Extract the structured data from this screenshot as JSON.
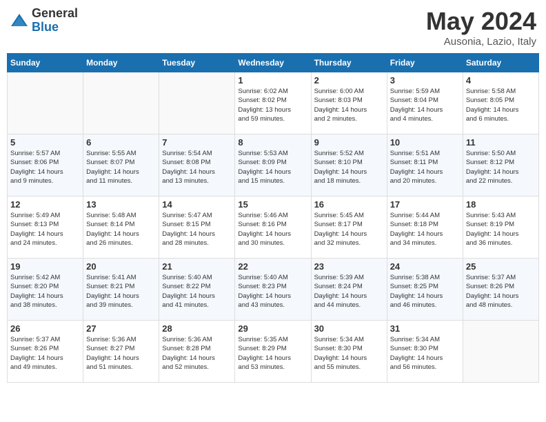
{
  "header": {
    "logo_general": "General",
    "logo_blue": "Blue",
    "month_title": "May 2024",
    "location": "Ausonia, Lazio, Italy"
  },
  "days_of_week": [
    "Sunday",
    "Monday",
    "Tuesday",
    "Wednesday",
    "Thursday",
    "Friday",
    "Saturday"
  ],
  "weeks": [
    [
      {
        "day": "",
        "info": ""
      },
      {
        "day": "",
        "info": ""
      },
      {
        "day": "",
        "info": ""
      },
      {
        "day": "1",
        "info": "Sunrise: 6:02 AM\nSunset: 8:02 PM\nDaylight: 13 hours\nand 59 minutes."
      },
      {
        "day": "2",
        "info": "Sunrise: 6:00 AM\nSunset: 8:03 PM\nDaylight: 14 hours\nand 2 minutes."
      },
      {
        "day": "3",
        "info": "Sunrise: 5:59 AM\nSunset: 8:04 PM\nDaylight: 14 hours\nand 4 minutes."
      },
      {
        "day": "4",
        "info": "Sunrise: 5:58 AM\nSunset: 8:05 PM\nDaylight: 14 hours\nand 6 minutes."
      }
    ],
    [
      {
        "day": "5",
        "info": "Sunrise: 5:57 AM\nSunset: 8:06 PM\nDaylight: 14 hours\nand 9 minutes."
      },
      {
        "day": "6",
        "info": "Sunrise: 5:55 AM\nSunset: 8:07 PM\nDaylight: 14 hours\nand 11 minutes."
      },
      {
        "day": "7",
        "info": "Sunrise: 5:54 AM\nSunset: 8:08 PM\nDaylight: 14 hours\nand 13 minutes."
      },
      {
        "day": "8",
        "info": "Sunrise: 5:53 AM\nSunset: 8:09 PM\nDaylight: 14 hours\nand 15 minutes."
      },
      {
        "day": "9",
        "info": "Sunrise: 5:52 AM\nSunset: 8:10 PM\nDaylight: 14 hours\nand 18 minutes."
      },
      {
        "day": "10",
        "info": "Sunrise: 5:51 AM\nSunset: 8:11 PM\nDaylight: 14 hours\nand 20 minutes."
      },
      {
        "day": "11",
        "info": "Sunrise: 5:50 AM\nSunset: 8:12 PM\nDaylight: 14 hours\nand 22 minutes."
      }
    ],
    [
      {
        "day": "12",
        "info": "Sunrise: 5:49 AM\nSunset: 8:13 PM\nDaylight: 14 hours\nand 24 minutes."
      },
      {
        "day": "13",
        "info": "Sunrise: 5:48 AM\nSunset: 8:14 PM\nDaylight: 14 hours\nand 26 minutes."
      },
      {
        "day": "14",
        "info": "Sunrise: 5:47 AM\nSunset: 8:15 PM\nDaylight: 14 hours\nand 28 minutes."
      },
      {
        "day": "15",
        "info": "Sunrise: 5:46 AM\nSunset: 8:16 PM\nDaylight: 14 hours\nand 30 minutes."
      },
      {
        "day": "16",
        "info": "Sunrise: 5:45 AM\nSunset: 8:17 PM\nDaylight: 14 hours\nand 32 minutes."
      },
      {
        "day": "17",
        "info": "Sunrise: 5:44 AM\nSunset: 8:18 PM\nDaylight: 14 hours\nand 34 minutes."
      },
      {
        "day": "18",
        "info": "Sunrise: 5:43 AM\nSunset: 8:19 PM\nDaylight: 14 hours\nand 36 minutes."
      }
    ],
    [
      {
        "day": "19",
        "info": "Sunrise: 5:42 AM\nSunset: 8:20 PM\nDaylight: 14 hours\nand 38 minutes."
      },
      {
        "day": "20",
        "info": "Sunrise: 5:41 AM\nSunset: 8:21 PM\nDaylight: 14 hours\nand 39 minutes."
      },
      {
        "day": "21",
        "info": "Sunrise: 5:40 AM\nSunset: 8:22 PM\nDaylight: 14 hours\nand 41 minutes."
      },
      {
        "day": "22",
        "info": "Sunrise: 5:40 AM\nSunset: 8:23 PM\nDaylight: 14 hours\nand 43 minutes."
      },
      {
        "day": "23",
        "info": "Sunrise: 5:39 AM\nSunset: 8:24 PM\nDaylight: 14 hours\nand 44 minutes."
      },
      {
        "day": "24",
        "info": "Sunrise: 5:38 AM\nSunset: 8:25 PM\nDaylight: 14 hours\nand 46 minutes."
      },
      {
        "day": "25",
        "info": "Sunrise: 5:37 AM\nSunset: 8:26 PM\nDaylight: 14 hours\nand 48 minutes."
      }
    ],
    [
      {
        "day": "26",
        "info": "Sunrise: 5:37 AM\nSunset: 8:26 PM\nDaylight: 14 hours\nand 49 minutes."
      },
      {
        "day": "27",
        "info": "Sunrise: 5:36 AM\nSunset: 8:27 PM\nDaylight: 14 hours\nand 51 minutes."
      },
      {
        "day": "28",
        "info": "Sunrise: 5:36 AM\nSunset: 8:28 PM\nDaylight: 14 hours\nand 52 minutes."
      },
      {
        "day": "29",
        "info": "Sunrise: 5:35 AM\nSunset: 8:29 PM\nDaylight: 14 hours\nand 53 minutes."
      },
      {
        "day": "30",
        "info": "Sunrise: 5:34 AM\nSunset: 8:30 PM\nDaylight: 14 hours\nand 55 minutes."
      },
      {
        "day": "31",
        "info": "Sunrise: 5:34 AM\nSunset: 8:30 PM\nDaylight: 14 hours\nand 56 minutes."
      },
      {
        "day": "",
        "info": ""
      }
    ]
  ]
}
